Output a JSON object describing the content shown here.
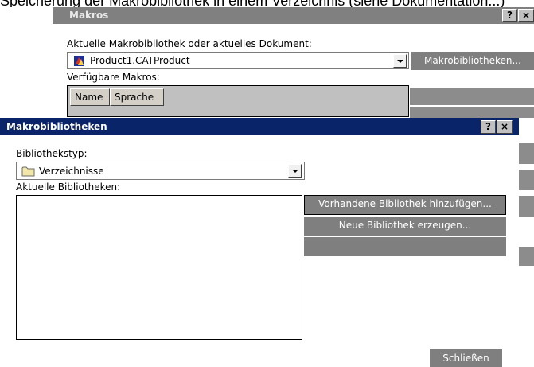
{
  "top_snippet": "Speicherung der Makrobibliothek in einem Verzeichnis (siehe Dokumentation...)",
  "makros_dialog": {
    "title": "Makros",
    "help_glyph": "?",
    "close_glyph": "×",
    "current_lib_label": "Aktuelle Makrobibliothek oder aktuelles Dokument:",
    "current_lib_value": "Product1.CATProduct",
    "libraries_button": "Makrobibliotheken...",
    "available_macros_label": "Verfügbare Makros:",
    "columns": [
      "Name",
      "Sprache"
    ]
  },
  "libs_dialog": {
    "title": "Makrobibliotheken",
    "help_glyph": "?",
    "close_glyph": "×",
    "lib_type_label": "Bibliothekstyp:",
    "lib_type_value": "Verzeichnisse",
    "current_libs_label": "Aktuelle Bibliotheken:",
    "add_existing_button": "Vorhandene Bibliothek hinzufügen...",
    "create_new_button": "Neue Bibliothek erzeugen...",
    "close_button": "Schließen"
  },
  "colors": {
    "active_title": "#0a246a",
    "inactive_title": "#808080",
    "button_dark": "#7f7f7f"
  }
}
